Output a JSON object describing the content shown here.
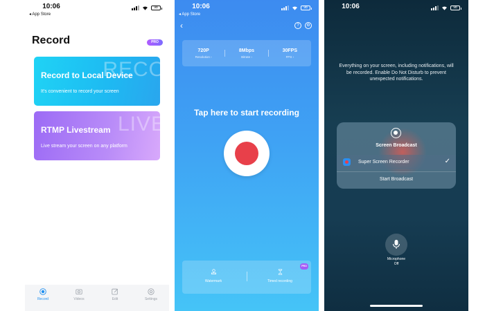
{
  "status_bar": {
    "time": "10:06",
    "back_app": "◂ App Store",
    "battery": "98"
  },
  "screen1": {
    "title": "Record",
    "pro_badge": "PRO",
    "cards": [
      {
        "title": "Record to Local Device",
        "subtitle": "It's convenient to record your screen",
        "watermark": "RECO"
      },
      {
        "title": "RTMP Livestream",
        "subtitle": "Live stream your screen on any platform",
        "watermark": "LIVE"
      }
    ],
    "tabs": [
      {
        "label": "Record",
        "icon": "record-icon",
        "active": true
      },
      {
        "label": "Videos",
        "icon": "videos-icon",
        "active": false
      },
      {
        "label": "Edit",
        "icon": "edit-icon",
        "active": false
      },
      {
        "label": "Settings",
        "icon": "settings-icon",
        "active": false
      }
    ],
    "accent": "#1f8ff0"
  },
  "screen2": {
    "settings": [
      {
        "value": "720P",
        "label": "Resolution ›"
      },
      {
        "value": "8Mbps",
        "label": "Bitrate ›"
      },
      {
        "value": "30FPS",
        "label": "FPS ›"
      }
    ],
    "start_text": "Tap here to start recording",
    "bottom_items": [
      {
        "label": "Watermark",
        "icon": "stamp-icon"
      },
      {
        "label": "Timed recording",
        "icon": "hourglass-icon"
      }
    ],
    "pro_badge": "PRO",
    "record_color": "#e8404a"
  },
  "screen3": {
    "time": "10:06",
    "notice": "Everything on your screen, including notifications, will be recorded. Enable Do Not Disturb to prevent unexpected notifications.",
    "broadcast_title": "Screen Broadcast",
    "app_name": "Super Screen Recorder",
    "check": "✓",
    "start_broadcast": "Start Broadcast",
    "microphone_label": "Microphone",
    "microphone_state": "Off"
  }
}
